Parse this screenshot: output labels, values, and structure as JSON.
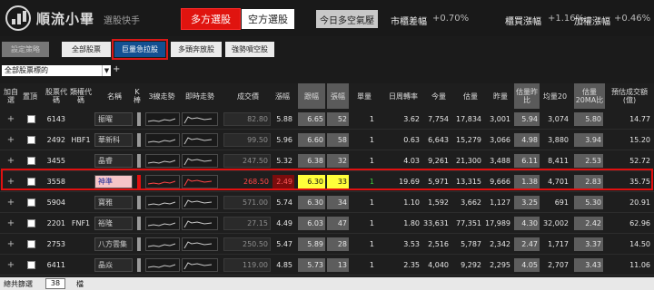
{
  "header": {
    "app_title": "順流小畢",
    "app_subtitle": "選股快手",
    "mode_long": "多方選股",
    "mode_short": "空方選股",
    "market_mood": "今日多空氣壓",
    "indices": [
      {
        "label": "市櫃差幅",
        "value": "+0.70%"
      },
      {
        "label": "櫃買漲幅",
        "value": "+1.16%"
      },
      {
        "label": "加權漲幅",
        "value": "+0.46%"
      }
    ]
  },
  "toolbar": {
    "set_strategy": "設定策略",
    "buttons": [
      "全部股票",
      "巨量急拉股",
      "多頭奔放股",
      "強勢噴空股"
    ],
    "active": "巨量急拉股"
  },
  "filter": {
    "selected": "全部股票標的"
  },
  "table": {
    "columns": [
      "加自選",
      "置頂",
      "股票代碼",
      "類權代碼",
      "名稱",
      "K棒",
      "3線走勢",
      "即時走勢",
      "成交價",
      "漲幅",
      "跟幅",
      "張幅",
      "單量",
      "日周轉率",
      "今量",
      "估量",
      "昨量",
      "估量昨比",
      "均量20",
      "估量20MA比",
      "預估成交額(億)"
    ],
    "rows": [
      {
        "code": "6143",
        "warrant": "",
        "name": "振曜",
        "price": "82.80",
        "change": "5.88",
        "c1": "6.65",
        "c2": "52",
        "lot": "1",
        "turnover": "3.62",
        "vol": "7,754",
        "est": "17,834",
        "yday": "3,001",
        "ratio": "5.94",
        "ma20": "3,074",
        "ma20ratio": "5.80",
        "amount": "14.77",
        "hl": false
      },
      {
        "code": "2492",
        "warrant": "HBF1",
        "name": "華新科",
        "price": "99.50",
        "change": "5.96",
        "c1": "6.60",
        "c2": "58",
        "lot": "1",
        "turnover": "0.63",
        "vol": "6,643",
        "est": "15,279",
        "yday": "3,066",
        "ratio": "4.98",
        "ma20": "3,880",
        "ma20ratio": "3.94",
        "amount": "15.20",
        "hl": false
      },
      {
        "code": "3455",
        "warrant": "",
        "name": "晶睿",
        "price": "247.50",
        "change": "5.32",
        "c1": "6.38",
        "c2": "32",
        "lot": "1",
        "turnover": "4.03",
        "vol": "9,261",
        "est": "21,300",
        "yday": "3,488",
        "ratio": "6.11",
        "ma20": "8,411",
        "ma20ratio": "2.53",
        "amount": "52.72",
        "hl": false
      },
      {
        "code": "3558",
        "warrant": "",
        "name": "神準",
        "price": "268.50",
        "change": "2.49",
        "c1": "6.30",
        "c2": "33",
        "lot": "1",
        "turnover": "19.69",
        "vol": "5,971",
        "est": "13,315",
        "yday": "9,666",
        "ratio": "1.38",
        "ma20": "4,701",
        "ma20ratio": "2.83",
        "amount": "35.75",
        "hl": true
      },
      {
        "code": "5904",
        "warrant": "",
        "name": "寶雅",
        "price": "571.00",
        "change": "5.74",
        "c1": "6.30",
        "c2": "34",
        "lot": "1",
        "turnover": "1.10",
        "vol": "1,592",
        "est": "3,662",
        "yday": "1,127",
        "ratio": "3.25",
        "ma20": "691",
        "ma20ratio": "5.30",
        "amount": "20.91",
        "hl": false
      },
      {
        "code": "2201",
        "warrant": "FNF1",
        "name": "裕隆",
        "price": "27.15",
        "change": "4.49",
        "c1": "6.03",
        "c2": "47",
        "lot": "1",
        "turnover": "1.80",
        "vol": "33,631",
        "est": "77,351",
        "yday": "17,989",
        "ratio": "4.30",
        "ma20": "32,002",
        "ma20ratio": "2.42",
        "amount": "62.96",
        "hl": false
      },
      {
        "code": "2753",
        "warrant": "",
        "name": "八方雲集",
        "price": "250.50",
        "change": "5.47",
        "c1": "5.89",
        "c2": "28",
        "lot": "1",
        "turnover": "3.53",
        "vol": "2,516",
        "est": "5,787",
        "yday": "2,342",
        "ratio": "2.47",
        "ma20": "1,717",
        "ma20ratio": "3.37",
        "amount": "14.50",
        "hl": false
      },
      {
        "code": "6411",
        "warrant": "",
        "name": "晶焱",
        "price": "119.00",
        "change": "4.85",
        "c1": "5.73",
        "c2": "13",
        "lot": "1",
        "turnover": "2.35",
        "vol": "4,040",
        "est": "9,292",
        "yday": "2,295",
        "ratio": "4.05",
        "ma20": "2,707",
        "ma20ratio": "3.43",
        "amount": "11.06",
        "hl": false
      }
    ]
  },
  "footer": {
    "label": "總共篩選",
    "count": "38",
    "unit": "檔"
  },
  "colors": {
    "accent_red": "#e0140f",
    "active_blue": "#135091",
    "highlight_yellow": "#ffff3a"
  }
}
